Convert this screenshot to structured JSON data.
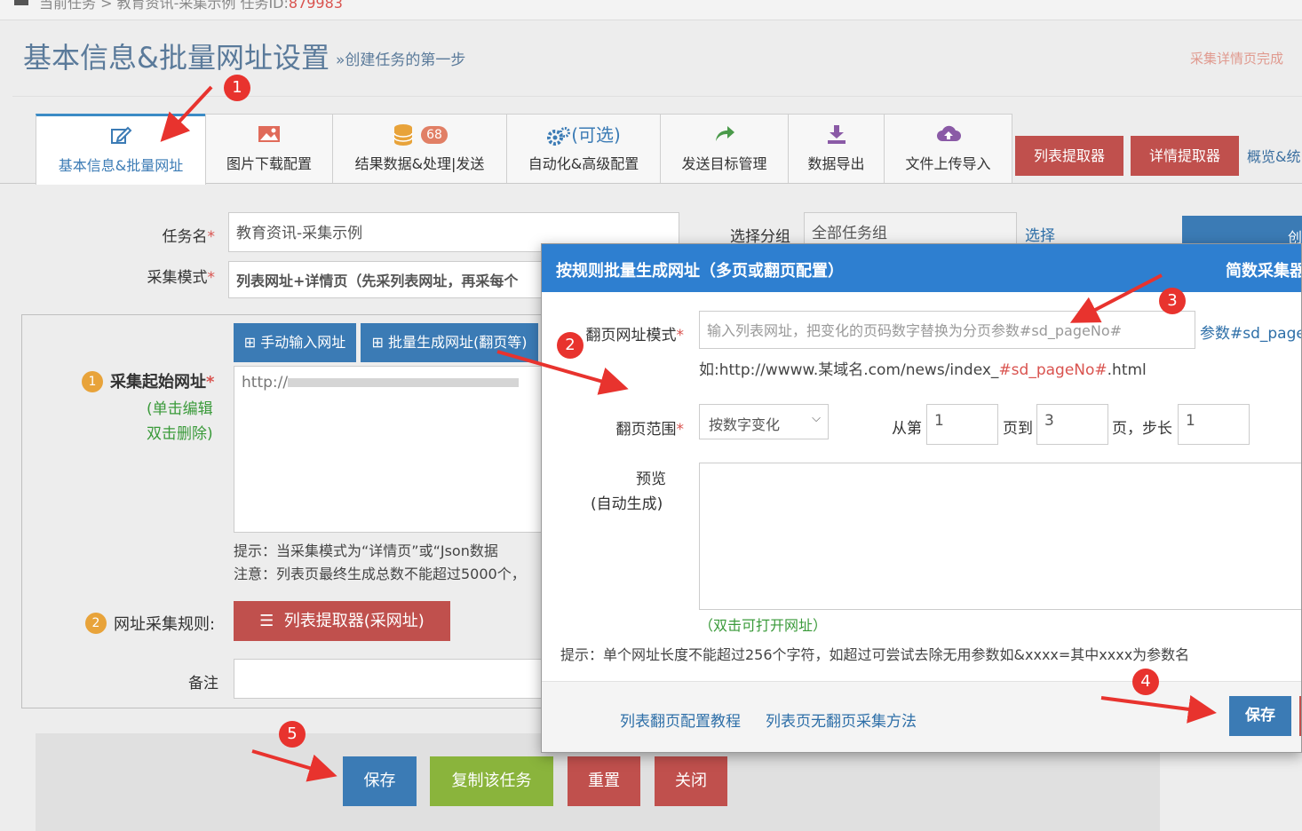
{
  "breadcrumb": {
    "current": "当前任务",
    "task": "教育资讯-采集示例 任务ID:",
    "task_id": "879983"
  },
  "header": {
    "title": "基本信息&批量网址设置",
    "subtitle": "»创建任务的第一步",
    "right_note": "采集详情页完成"
  },
  "tabs": [
    {
      "label": "基本信息&批量网址",
      "icon": "edit-icon"
    },
    {
      "label": "图片下载配置",
      "icon": "image-icon"
    },
    {
      "label": "结果数据&处理|发送",
      "icon": "database-icon",
      "badge": "68"
    },
    {
      "label": "自动化&高级配置",
      "icon": "gears-icon",
      "extra": "(可选)"
    },
    {
      "label": "发送目标管理",
      "icon": "share-icon"
    },
    {
      "label": "数据导出",
      "icon": "download-icon"
    },
    {
      "label": "文件上传导入",
      "icon": "cloud-upload-icon"
    }
  ],
  "tool_buttons": {
    "list_extractor": "列表提取器",
    "detail_extractor": "详情提取器",
    "overview": "概览&统"
  },
  "form": {
    "task_name_label": "任务名",
    "task_name_value": "教育资讯-采集示例",
    "group_label": "选择分组",
    "group_value": "全部任务组",
    "group_select_link": "选择",
    "mode_label": "采集模式",
    "mode_value": "列表网址+详情页（先采列表网址，再采每个",
    "create_button": "创",
    "manual_input_button": "手动输入网址",
    "batch_generate_button": "批量生成网址(翻页等)",
    "start_url_label": "采集起始网址",
    "start_url_num": "1",
    "start_url_help1": "(单击编辑",
    "start_url_help2": "双击删除)",
    "start_url_value": "http://",
    "hint1": "提示：当采集模式为“详情页”或“Json数据",
    "hint2": "注意：列表页最终生成总数不能超过5000个，",
    "rule_label": "网址采集规则:",
    "rule_num": "2",
    "rule_button": "列表提取器(采网址)",
    "note_label": "备注"
  },
  "bottom_buttons": {
    "save": "保存",
    "copy": "复制该任务",
    "reset": "重置",
    "close": "关闭"
  },
  "modal": {
    "title": "按规则批量生成网址（多页或翻页配置）",
    "brand": "简数采集器",
    "pattern_label": "翻页网址模式",
    "pattern_placeholder": "输入列表网址，把变化的页码数字替换为分页参数#sd_pageNo#",
    "param_link": "参数#sd_pageNo",
    "example_prefix": "如:http://wwww.某域名.com/news/index_",
    "example_param": "#sd_pageNo#",
    "example_suffix": ".html",
    "range_label": "翻页范围",
    "range_mode": "按数字变化",
    "from_label": "从第",
    "from_value": "1",
    "to_label": "页到",
    "to_value": "3",
    "step_label": "页，步长",
    "step_value": "1",
    "preview_label1": "预览",
    "preview_label2": "(自动生成)",
    "preview_hint": "（双击可打开网址）",
    "tip": "提示：单个网址长度不能超过256个字符，如超过可尝试去除无用参数如&xxxx=其中xxxx为参数名",
    "footer_link1": "列表翻页配置教程",
    "footer_link2": "列表页无翻页采集方法",
    "save_button": "保存"
  },
  "annotations": [
    "1",
    "2",
    "3",
    "4",
    "5"
  ],
  "colors": {
    "primary_blue": "#3b7bb5",
    "modal_header": "#2e7fd0",
    "danger_red": "#c0504d",
    "success_green": "#8ab43c",
    "marker_red": "#e8332e"
  }
}
